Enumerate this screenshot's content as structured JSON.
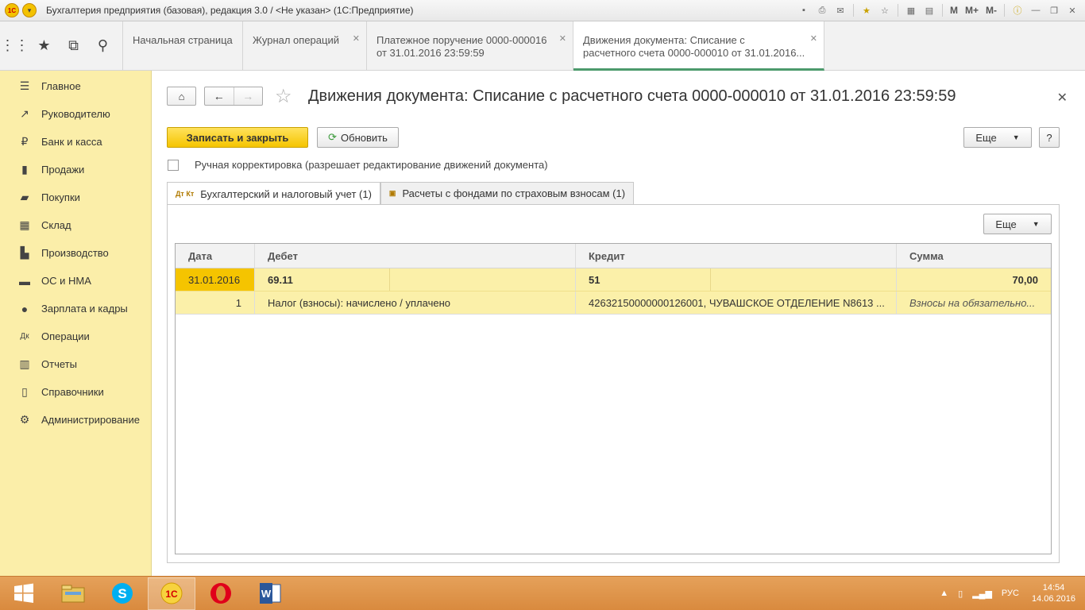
{
  "window": {
    "title": "Бухгалтерия предприятия (базовая), редакция 3.0 / <Не указан>  (1С:Предприятие)",
    "logo_text": "1С",
    "toolbar_icons": [
      "save-icon",
      "print-icon",
      "mail-icon",
      "favorites-add-icon",
      "favorites-icon",
      "calendar-icon",
      "calculator-icon"
    ],
    "m_labels": [
      "M",
      "M+",
      "M-"
    ],
    "controls": [
      "info-icon",
      "minimize-icon",
      "restore-icon",
      "close-icon"
    ]
  },
  "tabs_tools": [
    "apps-grid-icon",
    "favorites-star-icon",
    "history-icon",
    "search-icon"
  ],
  "tabs": [
    {
      "line1": "Начальная страница",
      "line2": ""
    },
    {
      "line1": "Журнал операций",
      "line2": ""
    },
    {
      "line1": "Платежное поручение 0000-000016",
      "line2": "от 31.01.2016 23:59:59"
    },
    {
      "line1": "Движения документа: Списание с",
      "line2": "расчетного счета 0000-000010 от 31.01.2016..."
    }
  ],
  "sidebar": [
    {
      "label": "Главное",
      "icon": "menu-icon"
    },
    {
      "label": "Руководителю",
      "icon": "trend-icon"
    },
    {
      "label": "Банк и касса",
      "icon": "ruble-icon"
    },
    {
      "label": "Продажи",
      "icon": "bag-icon"
    },
    {
      "label": "Покупки",
      "icon": "cart-icon"
    },
    {
      "label": "Склад",
      "icon": "warehouse-icon"
    },
    {
      "label": "Производство",
      "icon": "factory-icon"
    },
    {
      "label": "ОС и НМА",
      "icon": "truck-icon"
    },
    {
      "label": "Зарплата и кадры",
      "icon": "people-icon"
    },
    {
      "label": "Операции",
      "icon": "debit-credit-icon"
    },
    {
      "label": "Отчеты",
      "icon": "bar-chart-icon"
    },
    {
      "label": "Справочники",
      "icon": "book-icon"
    },
    {
      "label": "Администрирование",
      "icon": "gear-icon"
    }
  ],
  "form": {
    "title": "Движения документа: Списание с расчетного счета 0000-000010 от 31.01.2016 23:59:59",
    "save_close": "Записать и закрыть",
    "refresh": "Обновить",
    "more": "Еще",
    "help": "?",
    "manual_label": "Ручная корректировка (разрешает редактирование движений документа)",
    "manual_checked": false,
    "subtabs": [
      {
        "label": "Бухгалтерский и налоговый учет (1)",
        "icon_text": "Дт Кт"
      },
      {
        "label": "Расчеты с фондами по страховым взносам (1)",
        "icon_text": ""
      }
    ],
    "table_more": "Еще"
  },
  "table": {
    "headers": [
      "Дата",
      "Дебет",
      "Кредит",
      "Сумма"
    ],
    "row1": {
      "date": "31.01.2016",
      "debit": "69.11",
      "credit": "51",
      "sum": "70,00"
    },
    "row2": {
      "num": "1",
      "debit": "Налог (взносы): начислено / уплачено",
      "credit": "42632150000000126001, ЧУВАШСКОЕ ОТДЕЛЕНИЕ N8613 ...",
      "sum": "Взносы на обязательно..."
    }
  },
  "taskbar": {
    "apps": [
      "windows-start-icon",
      "file-explorer-icon",
      "skype-icon",
      "1c-icon",
      "opera-icon",
      "word-icon"
    ],
    "active_app": "1c-icon",
    "tray_lang": "РУС",
    "time": "14:54",
    "date": "14.06.2016"
  },
  "colors": {
    "sidebar_bg": "#fbeea9",
    "primary_button": "#f5c400",
    "taskbar": "#d98a3e",
    "active_tab_underline": "#4c9a6c"
  }
}
